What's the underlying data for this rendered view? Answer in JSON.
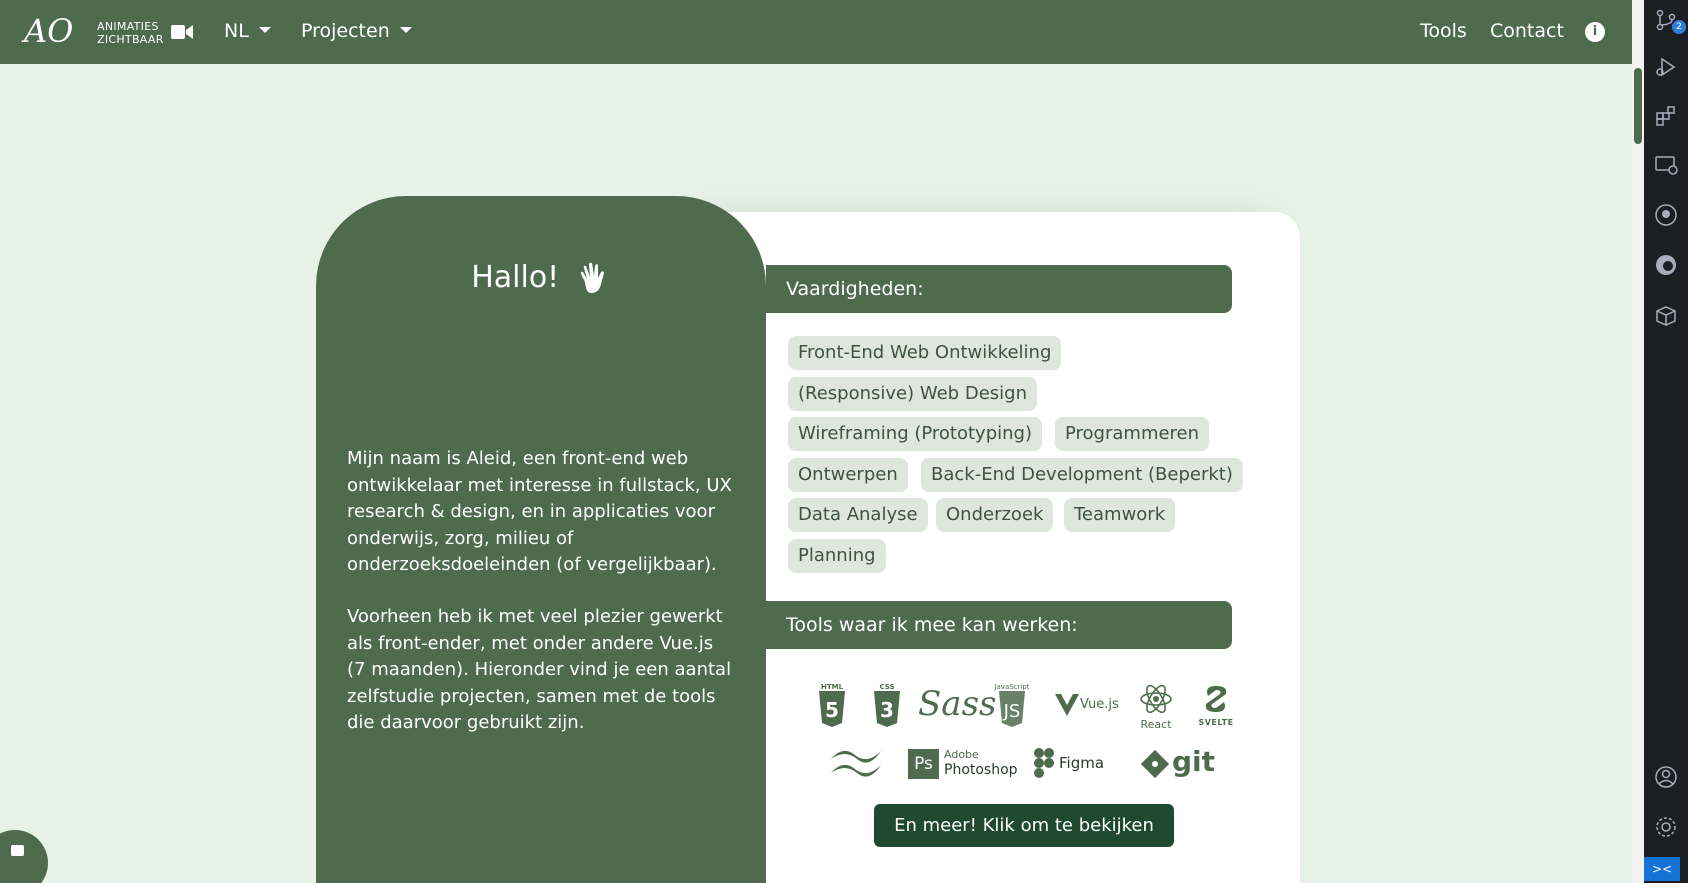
{
  "nav": {
    "logo": "AO",
    "brand_line1": "ANIMATIES",
    "brand_line2": "ZICHTBAAR",
    "lang": "NL",
    "projects": "Projecten",
    "tools": "Tools",
    "contact": "Contact"
  },
  "hero": {
    "greeting": "Hallo!",
    "bio_1": "Mijn naam is Aleid, een front-end web ontwikkelaar met interesse in fullstack, UX research & design, en in applicaties voor onderwijs, zorg, milieu of onderzoeksdoeleinden (of vergelijkbaar).",
    "bio_2": "Voorheen heb ik met veel plezier gewerkt als front-ender, met onder andere Vue.js (7 maanden). Hieronder vind je een aantal zelfstudie projecten, samen met de tools die daarvoor gebruikt zijn."
  },
  "skills": {
    "title": "Vaardigheden:",
    "items": [
      "Front-End Web Ontwikkeling",
      "(Responsive) Web Design",
      "Wireframing (Prototyping)",
      "Programmeren",
      "Ontwerpen",
      "Back-End Development (Beperkt)",
      "Data Analyse",
      "Onderzoek",
      "Teamwork",
      "Planning"
    ]
  },
  "tools": {
    "title": "Tools waar ik mee kan werken:",
    "logos": [
      "HTML",
      "CSS",
      "Sass",
      "JavaScript",
      "Vue.js",
      "React",
      "SVELTE",
      "Adobe",
      "Photoshop",
      "Figma",
      "git"
    ],
    "more_button": "En meer! Klik om te bekijken"
  },
  "sidebar": {
    "badge": "2"
  },
  "colors": {
    "primary": "#4e6b4d",
    "background": "#e8f3e8",
    "chip": "#dee6dd",
    "button": "#1f4a2f"
  }
}
